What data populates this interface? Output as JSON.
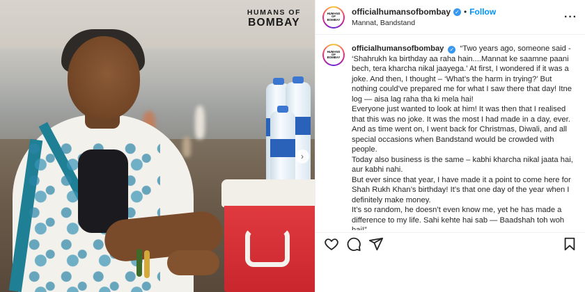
{
  "photo": {
    "watermark_line1": "HUMANS OF",
    "watermark_line2": "BOMBAY",
    "carousel_next": "›"
  },
  "post": {
    "username": "officialhumansofbombay",
    "verified_mark": "✓",
    "separator": "•",
    "follow_label": "Follow",
    "location": "Mannat, Bandstand",
    "more_label": "···",
    "avatar_text_line1": "HUMANS OF",
    "avatar_text_line2": "BOMBAY"
  },
  "caption": {
    "paragraphs": [
      "“Two years ago, someone said - ‘Shahrukh ka birthday aa raha hain....Mannat ke saamne paani bech, tera kharcha nikal jaayega.’ At first, I wondered if it was a joke. And then, I thought – ‘What’s the harm in trying?’ But nothing could’ve prepared me for what I saw there that day! Itne log — aisa lag raha tha ki mela hai!",
      "Everyone just wanted to look at him! It was then that I realised that this was no joke. It was the most I had made in a day, ever. And as time went on, I went back for Christmas, Diwali, and all special occasions when Bandstand would be crowded with people.",
      "Today also business is the same – kabhi kharcha nikal jaata hai, aur kabhi nahi.",
      "But ever since that year, I have made it a point to come here for Shah Rukh Khan’s birthday! It’s that one day of the year when I definitely make money.",
      "It’s so random, he doesn’t even know me, yet he has made a difference to my life. Sahi kehte hai sab — Baadshah toh woh hai!”"
    ]
  },
  "actions": {
    "like_icon": "heart-icon",
    "comment_icon": "comment-icon",
    "share_icon": "share-icon",
    "save_icon": "bookmark-icon"
  },
  "colors": {
    "follow_blue": "#0095f6",
    "verified_blue": "#3897f0",
    "cooler_red": "#d2252c",
    "saree_teal": "#1f7f95"
  }
}
